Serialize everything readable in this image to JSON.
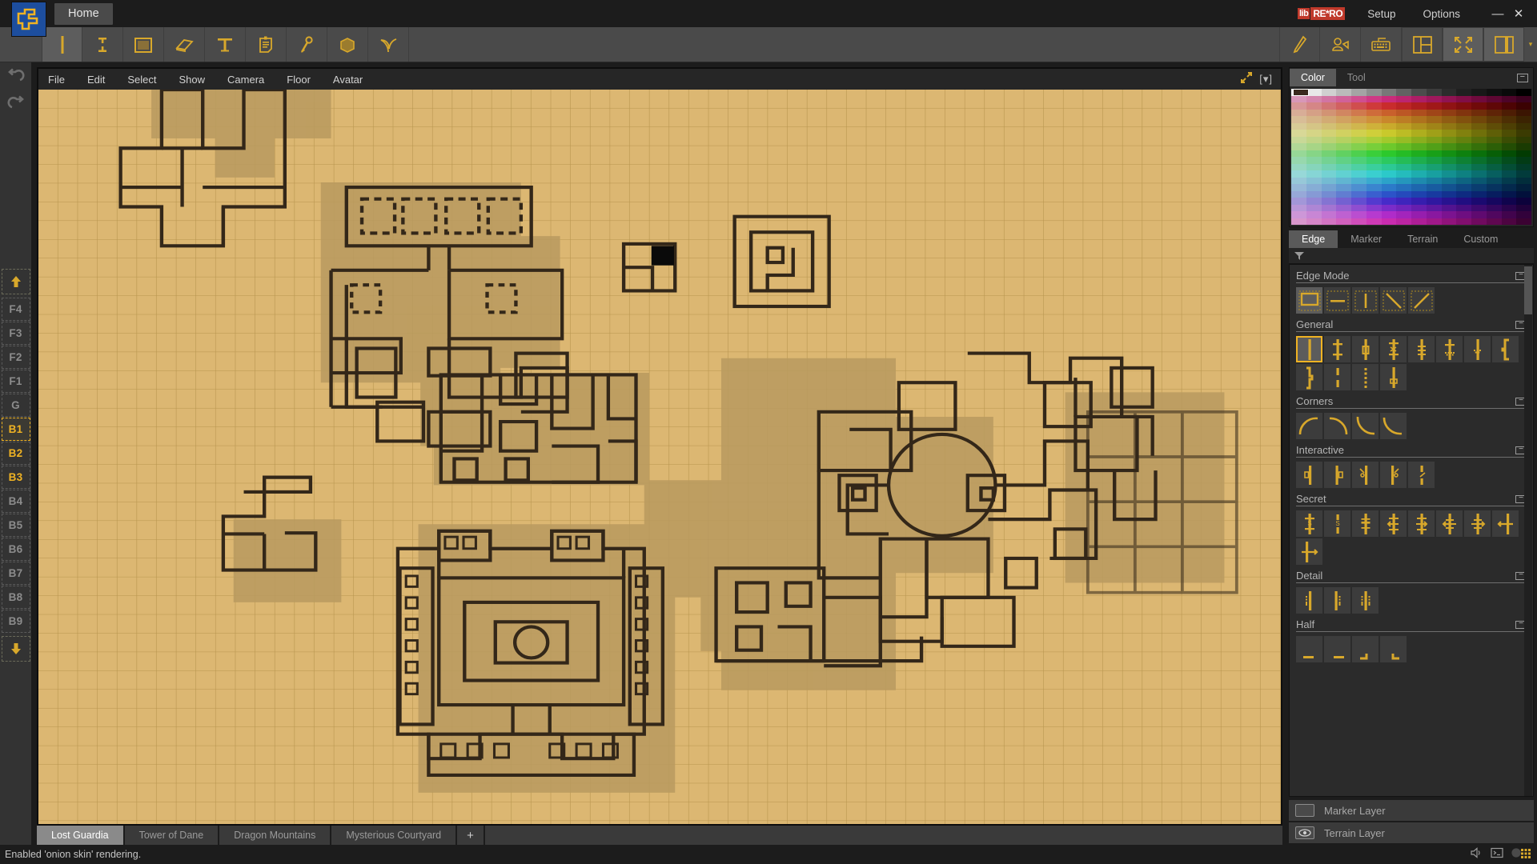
{
  "titlebar": {
    "home_tab": "Home",
    "brand_part1": "lib",
    "brand_part2": "RE*RO",
    "setup": "Setup",
    "options": "Options",
    "minimize": "—",
    "close": "✕",
    "logo_icon": "grid-cartographer-logo-icon"
  },
  "toolbar": {
    "left_tools": [
      {
        "name": "edge-tool",
        "icon": "vertical-bar-icon",
        "selected": true
      },
      {
        "name": "floor-tool",
        "icon": "double-t-icon",
        "selected": false
      },
      {
        "name": "fill-tool",
        "icon": "filled-square-icon",
        "selected": false
      },
      {
        "name": "eraser-tool",
        "icon": "eraser-icon",
        "selected": false
      },
      {
        "name": "text-tool",
        "icon": "text-t-icon",
        "selected": false
      },
      {
        "name": "note-tool",
        "icon": "note-clipboard-icon",
        "selected": false
      },
      {
        "name": "marker-tool",
        "icon": "pin-marker-icon",
        "selected": false
      },
      {
        "name": "terrain-tool",
        "icon": "terrain-block-icon",
        "selected": false
      },
      {
        "name": "plant-tool",
        "icon": "plant-sprout-icon",
        "selected": false
      }
    ],
    "right_tools": [
      {
        "name": "pen-tool",
        "icon": "pen-icon",
        "selected": false
      },
      {
        "name": "avatar-tool",
        "icon": "avatar-vehicle-icon",
        "selected": false
      },
      {
        "name": "keyboard-tool",
        "icon": "keyboard-icon",
        "selected": false
      },
      {
        "name": "split-view-toggle",
        "icon": "split-panel-icon",
        "selected": false
      },
      {
        "name": "fullscreen-toggle",
        "icon": "expand-arrows-icon",
        "selected": true
      },
      {
        "name": "sidebar-toggle",
        "icon": "right-panel-icon",
        "selected": true
      }
    ],
    "overflow_caret": "▾"
  },
  "left_rail": {
    "undo": "undo-arrow-icon",
    "redo": "redo-arrow-icon",
    "floor_up_icon": "floor-up-arrow-icon",
    "floors": [
      {
        "label": "F4",
        "state": "dim"
      },
      {
        "label": "F3",
        "state": "dim"
      },
      {
        "label": "F2",
        "state": "dim"
      },
      {
        "label": "F1",
        "state": "dim"
      },
      {
        "label": "G",
        "state": "dim"
      },
      {
        "label": "B1",
        "state": "current"
      },
      {
        "label": "B2",
        "state": "lit"
      },
      {
        "label": "B3",
        "state": "lit"
      },
      {
        "label": "B4",
        "state": "dim"
      },
      {
        "label": "B5",
        "state": "dim"
      },
      {
        "label": "B6",
        "state": "dim"
      },
      {
        "label": "B7",
        "state": "dim"
      },
      {
        "label": "B8",
        "state": "dim"
      },
      {
        "label": "B9",
        "state": "dim"
      }
    ],
    "floor_down_icon": "floor-down-arrow-icon"
  },
  "map": {
    "menu": [
      "File",
      "Edit",
      "Select",
      "Show",
      "Camera",
      "Floor",
      "Avatar"
    ],
    "expand_icon": "expand-diagonal-icon",
    "dropdown_label": "[▾]",
    "grid_color": "#b8954e",
    "paper_color": "#dcb772",
    "wall_color": "#332719",
    "shadow_color": "#b99a5f"
  },
  "map_tabs": {
    "tabs": [
      {
        "label": "Lost Guardia",
        "active": true
      },
      {
        "label": "Tower of Dane",
        "active": false
      },
      {
        "label": "Dragon Mountains",
        "active": false
      },
      {
        "label": "Mysterious Courtyard",
        "active": false
      }
    ],
    "add_label": "+"
  },
  "right_panel": {
    "top_tabs": [
      {
        "label": "Color",
        "active": true
      },
      {
        "label": "Tool",
        "active": false
      }
    ],
    "collapse_icon": "−",
    "current_color": "#3a2a1e",
    "sub_tabs": [
      {
        "label": "Edge",
        "active": true
      },
      {
        "label": "Marker",
        "active": false
      },
      {
        "label": "Terrain",
        "active": false
      },
      {
        "label": "Custom",
        "active": false
      }
    ],
    "filter_icon": "filter-funnel-icon",
    "sections": [
      {
        "title": "Edge Mode",
        "items": [
          {
            "name": "edge-mode-box",
            "icon": "box-edge-icon",
            "selected": true
          },
          {
            "name": "edge-mode-horizontal",
            "icon": "horizontal-edge-icon",
            "selected": false
          },
          {
            "name": "edge-mode-vertical",
            "icon": "vertical-edge-icon",
            "selected": false
          },
          {
            "name": "edge-mode-diag-back",
            "icon": "diagonal-back-icon",
            "selected": false
          },
          {
            "name": "edge-mode-diag-fwd",
            "icon": "diagonal-forward-icon",
            "selected": false
          }
        ]
      },
      {
        "title": "General",
        "items": [
          {
            "name": "edge-wall-solid",
            "icon": "solid-wall-icon",
            "selected": true
          },
          {
            "name": "edge-wall-tjoint",
            "icon": "t-joint-wall-icon",
            "selected": false
          },
          {
            "name": "edge-wall-pillar",
            "icon": "pillar-wall-icon",
            "selected": false
          },
          {
            "name": "edge-wall-crossed",
            "icon": "crossed-wall-icon",
            "selected": false
          },
          {
            "name": "edge-wall-dashed",
            "icon": "dashed-wall-icon",
            "selected": false
          },
          {
            "name": "edge-wall-rubble",
            "icon": "rubble-wall-icon",
            "selected": false
          },
          {
            "name": "edge-wall-arch",
            "icon": "arch-wall-icon",
            "selected": false
          },
          {
            "name": "edge-wall-bracket",
            "icon": "bracket-wall-icon",
            "selected": false
          },
          {
            "name": "edge-wall-zigzag",
            "icon": "zigzag-wall-icon",
            "selected": false
          },
          {
            "name": "edge-wall-broken",
            "icon": "broken-wall-icon",
            "selected": false
          },
          {
            "name": "edge-wall-dotted",
            "icon": "dotted-wall-icon",
            "selected": false
          },
          {
            "name": "edge-wall-window",
            "icon": "window-wall-icon",
            "selected": false
          }
        ]
      },
      {
        "title": "Corners",
        "items": [
          {
            "name": "corner-top-left",
            "icon": "corner-arc-tl-icon",
            "selected": false
          },
          {
            "name": "corner-top-right",
            "icon": "corner-arc-tr-icon",
            "selected": false
          },
          {
            "name": "corner-bottom-left",
            "icon": "corner-arc-bl-icon",
            "selected": false
          },
          {
            "name": "corner-bottom-right",
            "icon": "corner-arc-br-icon",
            "selected": false
          }
        ]
      },
      {
        "title": "Interactive",
        "items": [
          {
            "name": "door-left",
            "icon": "door-left-icon",
            "selected": false
          },
          {
            "name": "door-right",
            "icon": "door-right-icon",
            "selected": false
          },
          {
            "name": "door-open-left",
            "icon": "door-open-left-icon",
            "selected": false
          },
          {
            "name": "door-open-right",
            "icon": "door-open-right-icon",
            "selected": false
          },
          {
            "name": "door-broken",
            "icon": "door-broken-icon",
            "selected": false
          }
        ]
      },
      {
        "title": "Secret",
        "items": [
          {
            "name": "secret-s-door",
            "icon": "secret-s-icon",
            "selected": false
          },
          {
            "name": "secret-s-dashed",
            "icon": "secret-s-dashed-icon",
            "selected": false
          },
          {
            "name": "secret-plus",
            "icon": "secret-plus-icon",
            "selected": false
          },
          {
            "name": "secret-arrow-left",
            "icon": "arrow-left-wall-icon",
            "selected": false
          },
          {
            "name": "secret-arrow-right",
            "icon": "arrow-right-wall-icon",
            "selected": false
          },
          {
            "name": "secret-both-left",
            "icon": "both-arrows-left-icon",
            "selected": false
          },
          {
            "name": "secret-both-right",
            "icon": "both-arrows-right-icon",
            "selected": false
          },
          {
            "name": "secret-cross-left",
            "icon": "cross-left-icon",
            "selected": false
          },
          {
            "name": "secret-cross-right",
            "icon": "cross-right-icon",
            "selected": false
          }
        ]
      },
      {
        "title": "Detail",
        "items": [
          {
            "name": "detail-left",
            "icon": "detail-left-icon",
            "selected": false
          },
          {
            "name": "detail-right",
            "icon": "detail-right-icon",
            "selected": false
          },
          {
            "name": "detail-both",
            "icon": "detail-both-icon",
            "selected": false
          }
        ]
      },
      {
        "title": "Half",
        "items": [
          {
            "name": "half-a",
            "icon": "half-edge-a-icon",
            "selected": false
          },
          {
            "name": "half-b",
            "icon": "half-edge-b-icon",
            "selected": false
          },
          {
            "name": "half-c",
            "icon": "half-edge-c-icon",
            "selected": false
          },
          {
            "name": "half-d",
            "icon": "half-edge-d-icon",
            "selected": false
          }
        ]
      }
    ],
    "layers": [
      {
        "label": "Marker Layer",
        "icon": "layer-hidden-icon",
        "visible": false
      },
      {
        "label": "Terrain Layer",
        "icon": "layer-visible-eye-icon",
        "visible": true
      }
    ]
  },
  "statusbar": {
    "message": "Enabled 'onion skin' rendering.",
    "icons": [
      "speaker-icon",
      "console-icon",
      "dither-grid-icon"
    ]
  }
}
